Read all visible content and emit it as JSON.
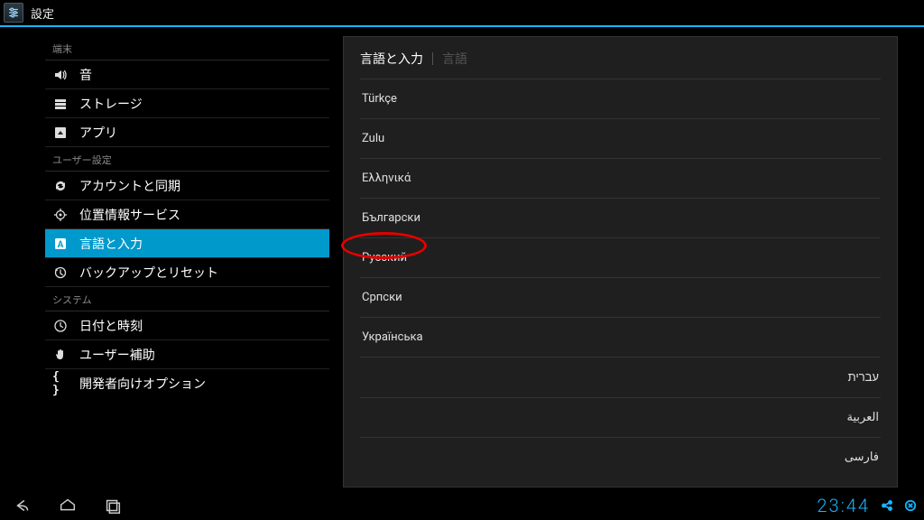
{
  "colors": {
    "accent": "#19b5fe",
    "selection": "#0099cc",
    "panel": "#1f1f1f",
    "annotation": "#e40000"
  },
  "topbar": {
    "title": "設定"
  },
  "sidebar": {
    "sections": [
      {
        "header": "端末",
        "items": [
          {
            "id": "sound",
            "label": "音",
            "icon": "volume-icon",
            "selected": false
          },
          {
            "id": "storage",
            "label": "ストレージ",
            "icon": "storage-icon",
            "selected": false
          },
          {
            "id": "apps",
            "label": "アプリ",
            "icon": "apps-icon",
            "selected": false
          }
        ]
      },
      {
        "header": "ユーザー設定",
        "items": [
          {
            "id": "accounts",
            "label": "アカウントと同期",
            "icon": "sync-icon",
            "selected": false
          },
          {
            "id": "location",
            "label": "位置情報サービス",
            "icon": "location-icon",
            "selected": false
          },
          {
            "id": "language",
            "label": "言語と入力",
            "icon": "language-icon",
            "selected": true
          },
          {
            "id": "backup",
            "label": "バックアップとリセット",
            "icon": "backup-icon",
            "selected": false
          }
        ]
      },
      {
        "header": "システム",
        "items": [
          {
            "id": "datetime",
            "label": "日付と時刻",
            "icon": "clock-icon",
            "selected": false
          },
          {
            "id": "a11y",
            "label": "ユーザー補助",
            "icon": "hand-icon",
            "selected": false
          },
          {
            "id": "dev",
            "label": "開発者向けオプション",
            "icon": "braces-icon",
            "selected": false
          }
        ]
      }
    ]
  },
  "main": {
    "header_primary": "言語と入力",
    "header_secondary": "言語",
    "languages": [
      {
        "label": "Türkçe",
        "rtl": false,
        "annotated": false
      },
      {
        "label": "Zulu",
        "rtl": false,
        "annotated": false
      },
      {
        "label": "Ελληνικά",
        "rtl": false,
        "annotated": false
      },
      {
        "label": "Български",
        "rtl": false,
        "annotated": false
      },
      {
        "label": "Русский",
        "rtl": false,
        "annotated": true
      },
      {
        "label": "Српски",
        "rtl": false,
        "annotated": false
      },
      {
        "label": "Українська",
        "rtl": false,
        "annotated": false
      },
      {
        "label": "עברית",
        "rtl": true,
        "annotated": false
      },
      {
        "label": "العربية",
        "rtl": true,
        "annotated": false
      },
      {
        "label": "فارسی",
        "rtl": true,
        "annotated": false
      }
    ]
  },
  "navbar": {
    "clock": "23:44"
  }
}
